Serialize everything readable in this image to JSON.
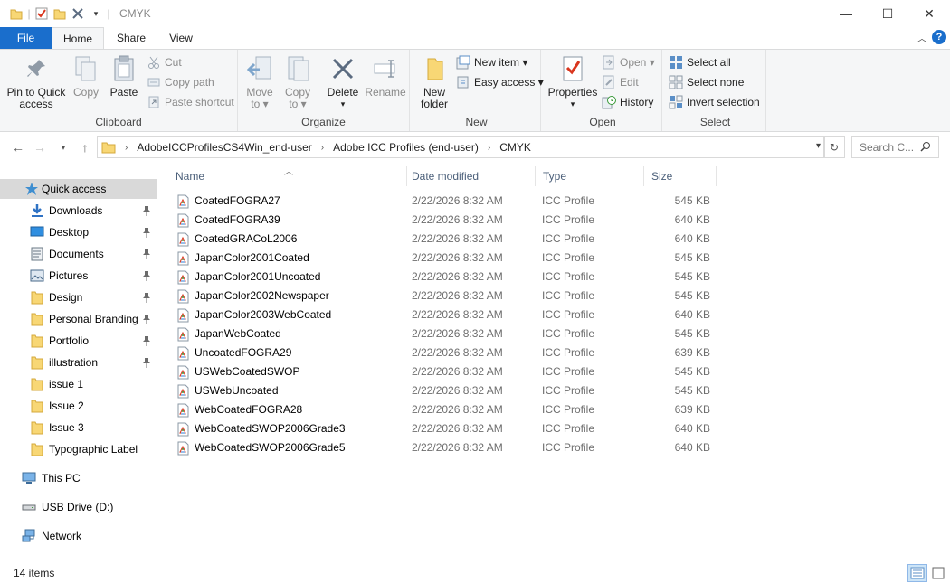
{
  "window": {
    "title": "CMYK",
    "minimize": "—",
    "maximize": "☐",
    "close": "✕"
  },
  "ribbon_tabs": {
    "file": "File",
    "home": "Home",
    "share": "Share",
    "view": "View",
    "help": "?"
  },
  "clipboard": {
    "label": "Clipboard",
    "pin_line1": "Pin to Quick",
    "pin_line2": "access",
    "copy": "Copy",
    "paste": "Paste",
    "cut": "Cut",
    "copy_path": "Copy path",
    "paste_shortcut": "Paste shortcut"
  },
  "organize": {
    "label": "Organize",
    "move_to_line1": "Move",
    "move_to_line2": "to ▾",
    "copy_to_line1": "Copy",
    "copy_to_line2": "to ▾",
    "delete": "Delete",
    "delete_arrow": "▾",
    "rename": "Rename"
  },
  "new_group": {
    "label": "New",
    "new_folder_line1": "New",
    "new_folder_line2": "folder",
    "new_item": "New item ▾",
    "easy_access": "Easy access ▾"
  },
  "open_group": {
    "label": "Open",
    "properties": "Properties",
    "properties_arrow": "▾",
    "open": "Open ▾",
    "edit": "Edit",
    "history": "History"
  },
  "select_group": {
    "label": "Select",
    "select_all": "Select all",
    "select_none": "Select none",
    "invert_selection": "Invert selection"
  },
  "address": {
    "crumbs": [
      "AdobeICCProfilesCS4Win_end-user",
      "Adobe ICC Profiles (end-user)",
      "CMYK"
    ],
    "search_placeholder": "Search C..."
  },
  "nav": {
    "quick_access": "Quick access",
    "items": [
      {
        "label": "Downloads",
        "icon": "download-icon",
        "pinned": true
      },
      {
        "label": "Desktop",
        "icon": "desktop-icon",
        "pinned": true
      },
      {
        "label": "Documents",
        "icon": "documents-icon",
        "pinned": true
      },
      {
        "label": "Pictures",
        "icon": "pictures-icon",
        "pinned": true
      },
      {
        "label": "Design",
        "icon": "folder-icon",
        "pinned": true
      },
      {
        "label": "Personal Branding",
        "icon": "folder-icon",
        "pinned": true
      },
      {
        "label": "Portfolio",
        "icon": "folder-icon",
        "pinned": true
      },
      {
        "label": "illustration",
        "icon": "folder-icon",
        "pinned": true
      },
      {
        "label": "issue 1",
        "icon": "folder-icon",
        "pinned": false
      },
      {
        "label": "Issue 2",
        "icon": "folder-icon",
        "pinned": false
      },
      {
        "label": "Issue 3",
        "icon": "folder-icon",
        "pinned": false
      },
      {
        "label": "Typographic Label",
        "icon": "folder-icon",
        "pinned": false
      }
    ],
    "this_pc": "This PC",
    "usb_drive": "USB Drive (D:)",
    "network": "Network"
  },
  "columns": {
    "name": "Name",
    "date_modified": "Date modified",
    "type": "Type",
    "size": "Size"
  },
  "files": [
    {
      "name": "CoatedFOGRA27",
      "date": "2/22/2026 8:32 AM",
      "type": "ICC Profile",
      "size": "545 KB"
    },
    {
      "name": "CoatedFOGRA39",
      "date": "2/22/2026 8:32 AM",
      "type": "ICC Profile",
      "size": "640 KB"
    },
    {
      "name": "CoatedGRACoL2006",
      "date": "2/22/2026 8:32 AM",
      "type": "ICC Profile",
      "size": "640 KB"
    },
    {
      "name": "JapanColor2001Coated",
      "date": "2/22/2026 8:32 AM",
      "type": "ICC Profile",
      "size": "545 KB"
    },
    {
      "name": "JapanColor2001Uncoated",
      "date": "2/22/2026 8:32 AM",
      "type": "ICC Profile",
      "size": "545 KB"
    },
    {
      "name": "JapanColor2002Newspaper",
      "date": "2/22/2026 8:32 AM",
      "type": "ICC Profile",
      "size": "545 KB"
    },
    {
      "name": "JapanColor2003WebCoated",
      "date": "2/22/2026 8:32 AM",
      "type": "ICC Profile",
      "size": "640 KB"
    },
    {
      "name": "JapanWebCoated",
      "date": "2/22/2026 8:32 AM",
      "type": "ICC Profile",
      "size": "545 KB"
    },
    {
      "name": "UncoatedFOGRA29",
      "date": "2/22/2026 8:32 AM",
      "type": "ICC Profile",
      "size": "639 KB"
    },
    {
      "name": "USWebCoatedSWOP",
      "date": "2/22/2026 8:32 AM",
      "type": "ICC Profile",
      "size": "545 KB"
    },
    {
      "name": "USWebUncoated",
      "date": "2/22/2026 8:32 AM",
      "type": "ICC Profile",
      "size": "545 KB"
    },
    {
      "name": "WebCoatedFOGRA28",
      "date": "2/22/2026 8:32 AM",
      "type": "ICC Profile",
      "size": "639 KB"
    },
    {
      "name": "WebCoatedSWOP2006Grade3",
      "date": "2/22/2026 8:32 AM",
      "type": "ICC Profile",
      "size": "640 KB"
    },
    {
      "name": "WebCoatedSWOP2006Grade5",
      "date": "2/22/2026 8:32 AM",
      "type": "ICC Profile",
      "size": "640 KB"
    }
  ],
  "status": {
    "item_count": "14 items"
  },
  "colors": {
    "accent": "#1a6ecc",
    "folder": "#f8d775",
    "selected_nav": "#d9d9d9"
  }
}
